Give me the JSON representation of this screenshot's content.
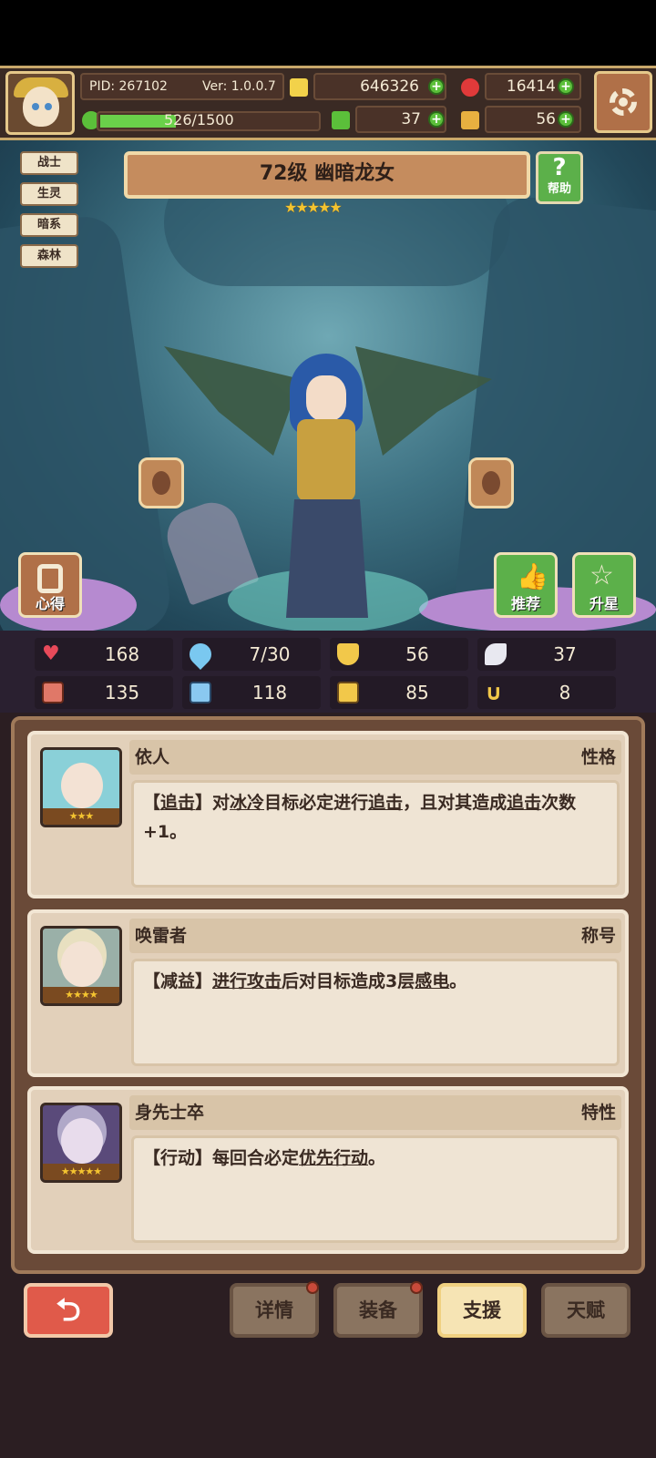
{
  "header": {
    "pid": "PID: 267102",
    "version": "Ver: 1.0.0.7",
    "gold": "646326",
    "gems": "16414",
    "exp": "526/1500",
    "exp_fraction": 0.35,
    "clover": "37",
    "tickets": "56"
  },
  "tags": [
    "战士",
    "生灵",
    "暗系",
    "森林"
  ],
  "hero": {
    "title": "72级 幽暗龙女",
    "stars": "★★★★★",
    "help_label": "帮助"
  },
  "side_buttons": {
    "insight": "心得",
    "recommend": "推荐",
    "star_up": "升星"
  },
  "stats": {
    "hp": "168",
    "mana": "7/30",
    "defense": "56",
    "speed": "37",
    "attack": "135",
    "magic": "118",
    "armor": "85",
    "luck": "8"
  },
  "cards": [
    {
      "name": "依人",
      "type": "性格",
      "stars": "★★★",
      "desc_parts": [
        "【",
        "追击",
        "】对",
        "冰冷",
        "目标必定进行",
        "追击",
        "，且对其造成",
        "追击",
        "次数+1。"
      ]
    },
    {
      "name": "唤雷者",
      "type": "称号",
      "stars": "★★★★",
      "desc_parts": [
        "【减益】",
        "进行攻击",
        "后对目标造成3层",
        "感电",
        "。"
      ]
    },
    {
      "name": "身先士卒",
      "type": "特性",
      "stars": "★★★★★",
      "desc_parts": [
        "【行动】每回合必定",
        "优先行动",
        "。"
      ]
    }
  ],
  "bottom_tabs": {
    "details": "详情",
    "equipment": "装备",
    "support": "支援",
    "talent": "天赋"
  },
  "colors": {
    "accent_gold": "#f0d9a8",
    "green_button": "#5cb04a",
    "back_red": "#e05a4a"
  }
}
